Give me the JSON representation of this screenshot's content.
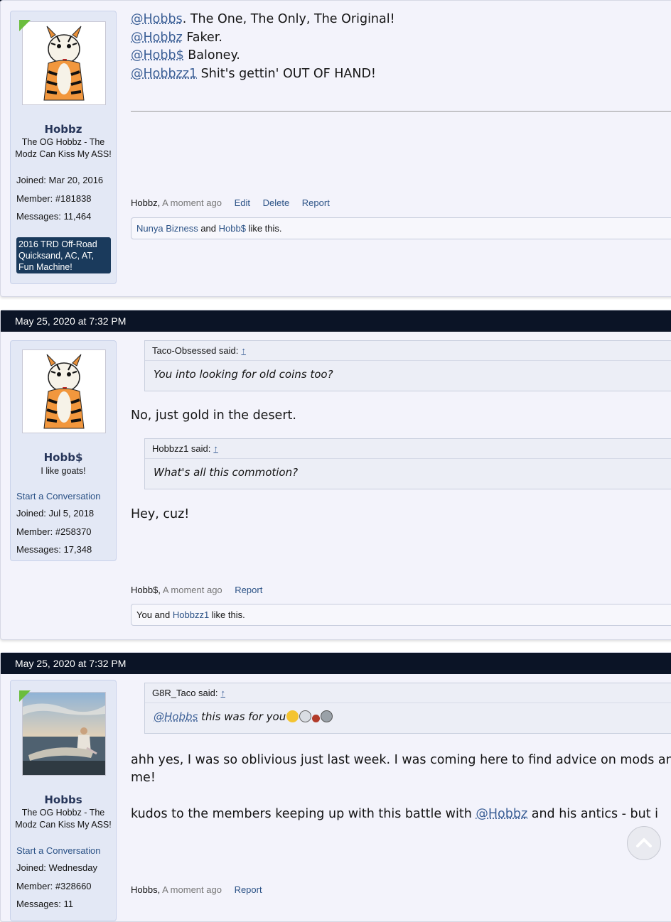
{
  "posts": [
    {
      "user": {
        "name": "Hobbz",
        "title": "The OG Hobbz - The Modz Can Kiss My ASS!",
        "joined_label": "Joined:",
        "joined": "Mar 20, 2016",
        "member_label": "Member:",
        "member": "#181838",
        "messages_label": "Messages:",
        "messages": "11,464",
        "banner": "2016 TRD Off-Road Quicksand, AC, AT, Fun Machine!"
      },
      "lines": [
        {
          "mention": "@Hobbs",
          "text": ". The One, The Only, The Original!"
        },
        {
          "mention": "@Hobbz",
          "text": " Faker."
        },
        {
          "mention": "@Hobb$",
          "text": " Baloney."
        },
        {
          "mention": "@Hobbzz1",
          "text": " Shit's gettin' OUT OF HAND!"
        }
      ],
      "meta": {
        "author": "Hobbz,",
        "time": "A moment ago",
        "edit": "Edit",
        "delete": "Delete",
        "report": "Report"
      },
      "likes": {
        "user1": "Nunya Bizness",
        "and": " and ",
        "user2": "Hobb$",
        "suffix": " like this."
      }
    },
    {
      "date": "May 25, 2020 at 7:32 PM",
      "user": {
        "name": "Hobb$",
        "title": "I like goats!",
        "start_conversation": "Start a Conversation",
        "joined_label": "Joined:",
        "joined": "Jul 5, 2018",
        "member_label": "Member:",
        "member": "#258370",
        "messages_label": "Messages:",
        "messages": "17,348"
      },
      "quotes": [
        {
          "author": "Taco-Obsessed said:",
          "arrow": "↑",
          "body": "You into looking for old coins too?"
        },
        {
          "author": "Hobbzz1 said:",
          "arrow": "↑",
          "body": "What's all this commotion?"
        }
      ],
      "reply1": "No, just gold in the desert.",
      "reply2": "Hey, cuz!",
      "meta": {
        "author": "Hobb$,",
        "time": "A moment ago",
        "report": "Report"
      },
      "likes": {
        "prefix": "You and ",
        "user1": "Hobbzz1",
        "suffix": " like this."
      }
    },
    {
      "date": "May 25, 2020 at 7:32 PM",
      "user": {
        "name": "Hobbs",
        "title": "The OG Hobbz - The Modz Can Kiss My ASS!",
        "start_conversation": "Start a Conversation",
        "joined_label": "Joined:",
        "joined": "Wednesday",
        "member_label": "Member:",
        "member": "#328660",
        "messages_label": "Messages:",
        "messages": "11"
      },
      "quote": {
        "author": "G8R_Taco said:",
        "arrow": "↑",
        "mention": "@Hobbs",
        "body": " this was for you"
      },
      "para1": "ahh yes, I was so oblivious just last week. I was coming here to find advice on mods and",
      "para1b": "me!",
      "para2_pre": "kudos to the members keeping up with this battle with ",
      "para2_mention": "@Hobbz",
      "para2_post": " and his antics - but i",
      "meta": {
        "author": "Hobbs,",
        "time": "A moment ago",
        "report": "Report"
      }
    }
  ],
  "scroll_top_icon": "chevron-up-icon",
  "colors": {
    "header": "#0b1426",
    "link": "#2b5286",
    "post_bg": "#f3f3fb",
    "userblock_bg": "#e3e8f5",
    "corner": "#6bbd3e"
  }
}
